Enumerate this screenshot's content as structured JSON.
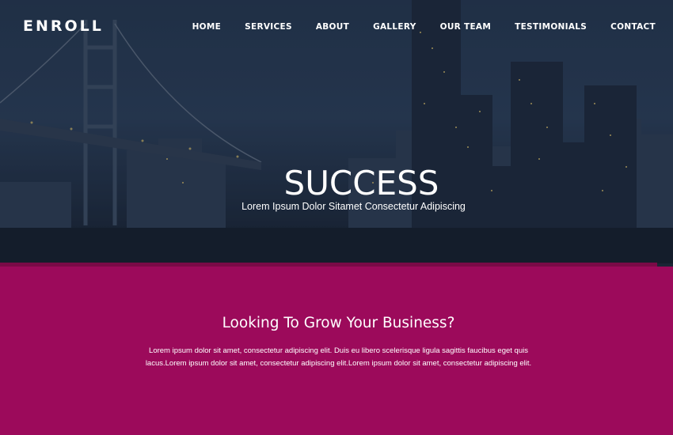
{
  "brand": {
    "logo": "ENROLL"
  },
  "nav": {
    "items": [
      {
        "label": "HOME"
      },
      {
        "label": "SERVICES"
      },
      {
        "label": "ABOUT"
      },
      {
        "label": "GALLERY"
      },
      {
        "label": "OUR TEAM"
      },
      {
        "label": "TESTIMONIALS"
      },
      {
        "label": "CONTACT"
      }
    ]
  },
  "hero": {
    "title": "SUCCESS",
    "subtitle": "Lorem Ipsum Dolor Sitamet Consectetur Adipiscing"
  },
  "promo": {
    "heading": "Looking To Grow Your Business?",
    "body": "Lorem ipsum dolor sit amet, consectetur adipiscing elit. Duis eu libero scelerisque ligula sagittis faucibus eget quis lacus.Lorem ipsum dolor sit amet, consectetur adipiscing elit.Lorem ipsum dolor sit amet, consectetur adipiscing elit."
  },
  "colors": {
    "promo_bg": "#9c0a5b",
    "strip": "#7a0a47",
    "hero_sky": "#24354c"
  }
}
